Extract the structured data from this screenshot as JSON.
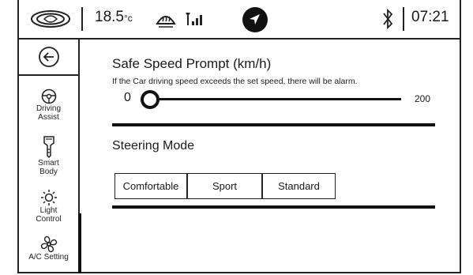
{
  "status_bar": {
    "logo": "brand-logo",
    "temperature": "18.5",
    "temperature_unit": "°c",
    "icons": [
      "defrost-icon",
      "signal-icon",
      "navigation-icon",
      "bluetooth-icon"
    ],
    "time": "07:21"
  },
  "sidebar": {
    "back": "back-arrow-icon",
    "items": [
      {
        "label": "Driving\nAssist",
        "icon": "steering-wheel-icon"
      },
      {
        "label": "Smart\nBody",
        "icon": "key-icon"
      },
      {
        "label": "Light\nControl",
        "icon": "light-bulb-icon"
      },
      {
        "label": "A/C Setting",
        "icon": "fan-icon"
      }
    ],
    "active_item": "A/C Setting"
  },
  "speed_prompt": {
    "title": "Safe Speed Prompt (km/h)",
    "description": "If the Car driving speed exceeds the set speed, there will be alarm.",
    "min": "0",
    "max": "200",
    "value": 0
  },
  "steering_mode": {
    "title": "Steering Mode",
    "options": [
      "Comfortable",
      "Sport",
      "Standard"
    ]
  },
  "colors": {
    "foreground": "#111111",
    "background": "#ffffff"
  }
}
